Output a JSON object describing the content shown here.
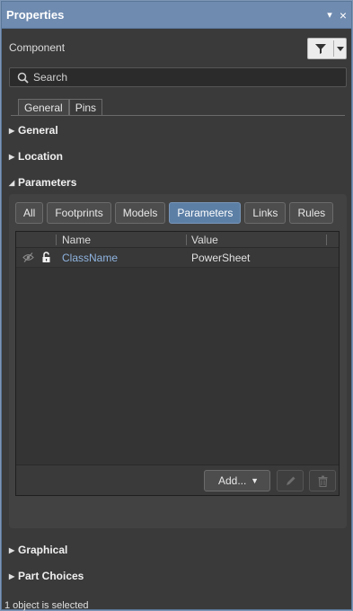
{
  "window": {
    "title": "Properties",
    "pin_glyph": "▾",
    "close_glyph": "×"
  },
  "component": {
    "label": "Component"
  },
  "search": {
    "placeholder": "Search"
  },
  "tabs": [
    {
      "label": "General",
      "active": true
    },
    {
      "label": "Pins",
      "active": false
    }
  ],
  "sections": {
    "general": {
      "label": "General",
      "expanded": false
    },
    "location": {
      "label": "Location",
      "expanded": false
    },
    "parameters": {
      "label": "Parameters",
      "expanded": true
    },
    "graphical": {
      "label": "Graphical",
      "expanded": false
    },
    "part_choices": {
      "label": "Part Choices",
      "expanded": false
    }
  },
  "filters": [
    {
      "label": "All",
      "active": false
    },
    {
      "label": "Footprints",
      "active": false
    },
    {
      "label": "Models",
      "active": false
    },
    {
      "label": "Parameters",
      "active": true
    },
    {
      "label": "Links",
      "active": false
    },
    {
      "label": "Rules",
      "active": false
    }
  ],
  "table": {
    "headers": {
      "name": "Name",
      "value": "Value"
    },
    "rows": [
      {
        "name": "ClassName",
        "value": "PowerSheet",
        "visibility_icon": "eye-hidden-icon",
        "lock_icon": "unlocked-icon"
      }
    ]
  },
  "actions": {
    "add_label": "Add..."
  },
  "status": {
    "text": "1 object is selected"
  },
  "colors": {
    "accent": "#5c7fa6",
    "titlebar": "#6f8bb0",
    "link": "#8fb4e0"
  }
}
